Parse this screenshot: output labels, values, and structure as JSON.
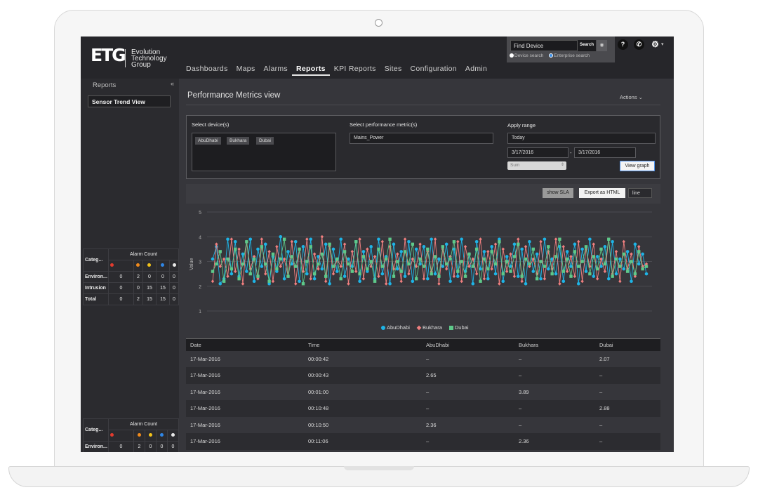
{
  "brand": {
    "mark": "ETG",
    "line1": "Evolution",
    "line2": "Technology",
    "line3": "Group"
  },
  "nav": [
    "Dashboards",
    "Maps",
    "Alarms",
    "Reports",
    "KPI Reports",
    "Sites",
    "Configuration",
    "Admin"
  ],
  "active_nav": "Reports",
  "search": {
    "placeholder": "Find Device",
    "button": "Search",
    "opt_device": "Device search",
    "opt_enterprise": "Enterprise search"
  },
  "top_icons": {
    "help": "?",
    "phone": "✆",
    "settings": "⚙"
  },
  "sidebar": {
    "title": "Reports",
    "collapse": "«",
    "item": "Sensor Trend View"
  },
  "alarm_panel": {
    "col_category": "Categ...",
    "col_count": "Alarm Count",
    "severity_colors": [
      "#e23b2e",
      "#f08a1c",
      "#f2c21a",
      "#2f86e6",
      "#e8e8e8"
    ],
    "rows": [
      {
        "name": "Environ...",
        "values": [
          "0",
          "2",
          "0",
          "0",
          "0"
        ]
      },
      {
        "name": "Intrusion",
        "values": [
          "0",
          "0",
          "15",
          "15",
          "0"
        ]
      },
      {
        "name": "Total",
        "values": [
          "0",
          "2",
          "15",
          "15",
          "0"
        ]
      }
    ],
    "rows2": [
      {
        "name": "Environ...",
        "values": [
          "0",
          "2",
          "0",
          "0",
          "0"
        ]
      }
    ]
  },
  "page": {
    "title": "Performance Metrics view",
    "actions": "Actions ⌄"
  },
  "selector": {
    "devices_label": "Select device(s)",
    "devices": [
      "AbuDhabi",
      "Bukhara",
      "Dubai"
    ],
    "metric_label": "Select performance metric(s)",
    "metric_value": "Mains_Power",
    "range_label": "Apply range",
    "range_value": "Today",
    "date_from": "3/17/2016",
    "date_sep": "-",
    "date_to": "3/17/2016",
    "agg_value": "Sum",
    "view_button": "View graph"
  },
  "toolbar": {
    "sla": "show SLA",
    "export": "Export as HTML",
    "type": "line"
  },
  "chart_data": {
    "type": "line",
    "ylabel": "Value",
    "ylim": [
      1,
      5
    ],
    "yticks": [
      "1",
      "2",
      "3",
      "4",
      "5"
    ],
    "grid": true,
    "legend_position": "bottom",
    "series": [
      {
        "name": "AbuDhabi",
        "color": "#1eb4e6",
        "marker": "circle",
        "values": [
          3.1,
          3.6,
          2.1,
          2.3,
          3.9,
          2.5,
          3.8,
          2.4,
          3.3,
          2.6,
          3.9,
          2.2,
          3.5,
          2.8,
          3.7,
          2.1,
          3.2,
          2.6,
          4.0,
          2.3,
          3.4,
          2.9,
          3.8,
          2.2,
          3.6,
          2.5,
          3.9,
          2.3,
          3.2,
          2.7,
          3.7,
          2.1,
          3.5,
          2.6,
          3.9,
          2.4,
          3.1,
          2.8,
          3.8,
          2.2,
          3.4,
          2.6,
          3.6,
          2.3,
          3.9,
          2.5,
          3.2,
          2.1,
          3.7,
          2.7,
          3.4,
          2.4,
          3.8,
          2.2,
          3.5,
          2.9,
          3.6,
          2.3,
          3.9,
          2.5,
          3.1,
          2.8,
          3.7,
          2.2,
          3.5,
          2.4,
          3.9,
          2.6,
          3.3,
          2.1,
          3.8,
          2.7,
          3.4,
          2.3,
          3.6,
          2.5,
          3.9,
          2.2,
          3.2,
          2.8,
          3.7,
          2.4,
          3.5,
          2.1,
          3.8,
          2.6,
          3.3,
          2.3,
          3.9,
          2.7,
          3.1,
          2.5,
          3.6,
          2.2,
          3.4,
          2.8,
          3.7,
          2.1,
          3.5,
          2.6,
          3.9,
          2.4,
          3.2,
          2.8,
          3.6,
          2.3,
          3.8,
          2.5,
          3.1,
          2.7,
          3.4,
          2.2,
          3.7,
          2.9,
          3.3,
          2.5
        ]
      },
      {
        "name": "Bukhara",
        "color": "#f07f7f",
        "marker": "diamond",
        "values": [
          2.2,
          3.7,
          2.8,
          3.1,
          2.4,
          3.9,
          2.6,
          3.5,
          2.1,
          3.8,
          2.7,
          3.2,
          2.3,
          3.9,
          2.5,
          3.4,
          2.2,
          3.6,
          2.8,
          3.1,
          2.4,
          3.8,
          2.1,
          3.5,
          2.6,
          3.9,
          2.3,
          3.3,
          2.7,
          4.0,
          2.2,
          3.6,
          2.5,
          3.1,
          2.8,
          3.7,
          2.1,
          3.4,
          2.6,
          3.9,
          2.3,
          3.5,
          2.8,
          3.2,
          2.4,
          3.8,
          2.1,
          3.6,
          2.7,
          3.3,
          2.2,
          3.9,
          2.5,
          3.1,
          2.8,
          3.7,
          2.3,
          3.4,
          2.6,
          3.9,
          2.1,
          3.5,
          2.7,
          3.2,
          2.4,
          3.8,
          2.2,
          3.6,
          2.8,
          3.1,
          2.5,
          3.9,
          2.3,
          3.4,
          2.7,
          3.7,
          2.1,
          3.5,
          2.6,
          3.3,
          2.4,
          3.9,
          2.2,
          3.6,
          2.8,
          3.1,
          2.5,
          3.8,
          2.3,
          3.4,
          2.7,
          3.9,
          2.1,
          3.6,
          2.6,
          3.2,
          2.4,
          3.8,
          2.2,
          3.5,
          2.8,
          3.7,
          2.3,
          3.1,
          2.6,
          3.9,
          2.5,
          3.4,
          2.2,
          3.8,
          2.7,
          3.3,
          2.4,
          3.6,
          2.8,
          2.9
        ]
      },
      {
        "name": "Dubai",
        "color": "#5ec98a",
        "marker": "square",
        "values": [
          2.6,
          2.9,
          3.4,
          2.2,
          3.1,
          2.7,
          3.5,
          2.3,
          2.9,
          3.8,
          2.5,
          3.1,
          2.4,
          3.6,
          2.9,
          2.2,
          3.3,
          2.7,
          3.1,
          3.9,
          2.4,
          3.2,
          2.8,
          3.5,
          2.1,
          3.0,
          3.6,
          2.5,
          2.9,
          3.3,
          2.4,
          3.7,
          2.8,
          3.1,
          2.3,
          3.4,
          2.9,
          2.6,
          3.8,
          2.5,
          3.2,
          2.7,
          3.0,
          2.2,
          3.5,
          2.8,
          3.1,
          3.9,
          2.4,
          3.0,
          2.6,
          3.4,
          2.9,
          3.7,
          2.3,
          3.1,
          2.8,
          3.5,
          2.5,
          3.2,
          2.4,
          3.6,
          2.9,
          3.1,
          3.8,
          2.6,
          3.0,
          2.4,
          3.3,
          2.8,
          3.5,
          2.2,
          3.1,
          2.7,
          3.4,
          2.9,
          3.8,
          2.5,
          3.0,
          2.6,
          3.2,
          3.7,
          2.4,
          3.1,
          2.9,
          3.5,
          2.3,
          3.0,
          2.8,
          3.6,
          2.5,
          3.2,
          3.9,
          2.6,
          3.1,
          2.4,
          3.4,
          2.8,
          3.0,
          3.6,
          2.5,
          3.2,
          2.7,
          3.5,
          2.9,
          3.9,
          2.4,
          3.1,
          2.8,
          3.3,
          2.6,
          3.0,
          2.5,
          3.4,
          2.7,
          2.8
        ]
      }
    ]
  },
  "table": {
    "headers": [
      "Date",
      "Time",
      "AbuDhabi",
      "Bukhara",
      "Dubai"
    ],
    "rows": [
      [
        "17-Mar-2016",
        "00:00:42",
        "–",
        "–",
        "2.07"
      ],
      [
        "17-Mar-2016",
        "00:00:43",
        "2.65",
        "–",
        "–"
      ],
      [
        "17-Mar-2016",
        "00:01:00",
        "–",
        "3.89",
        "–"
      ],
      [
        "17-Mar-2016",
        "00:10:48",
        "–",
        "–",
        "2.88"
      ],
      [
        "17-Mar-2016",
        "00:10:50",
        "2.36",
        "–",
        "–"
      ],
      [
        "17-Mar-2016",
        "00:11:06",
        "–",
        "2.36",
        "–"
      ]
    ]
  }
}
